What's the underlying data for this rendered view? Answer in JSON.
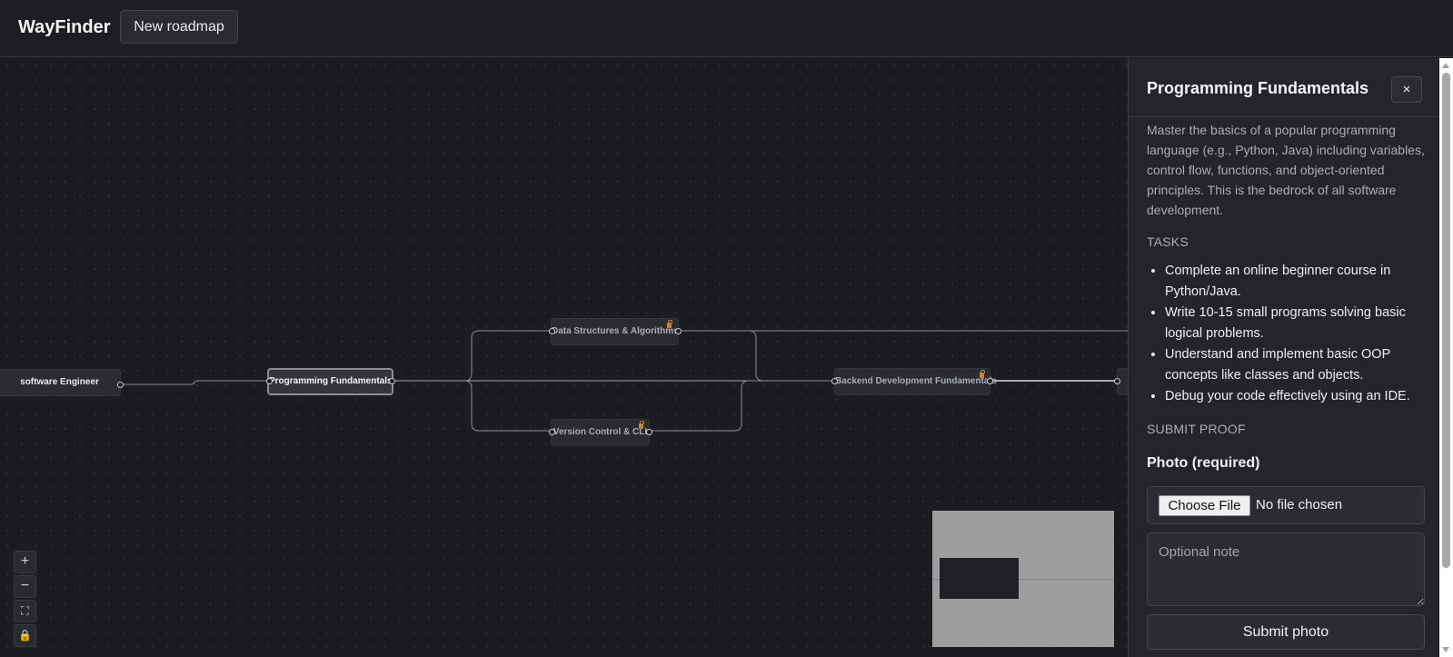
{
  "header": {
    "brand": "WayFinder",
    "new_roadmap_label": "New roadmap"
  },
  "roadmap": {
    "nodes": [
      {
        "id": "software-engineer",
        "label": "software Engineer",
        "state": "root"
      },
      {
        "id": "programming-fundamentals",
        "label": "Programming Fundamentals",
        "state": "active"
      },
      {
        "id": "data-structures",
        "label": "Data Structures & Algorithms",
        "state": "locked"
      },
      {
        "id": "version-control",
        "label": "Version Control & CLI",
        "state": "locked"
      },
      {
        "id": "backend-fundamentals",
        "label": "Backend Development Fundamentals",
        "state": "locked"
      },
      {
        "id": "next-node",
        "label": "",
        "state": "locked"
      }
    ],
    "controls": {
      "zoom_in": "+",
      "zoom_out": "−",
      "fit_view": "⛶",
      "lock": "🔒"
    }
  },
  "panel": {
    "title": "Programming Fundamentals",
    "close_label": "×",
    "description": "Master the basics of a popular programming language (e.g., Python, Java) including variables, control flow, functions, and object-oriented principles. This is the bedrock of all software development.",
    "tasks_heading": "TASKS",
    "tasks": [
      "Complete an online beginner course in Python/Java.",
      "Write 10-15 small programs solving basic logical problems.",
      "Understand and implement basic OOP concepts like classes and objects.",
      "Debug your code effectively using an IDE."
    ],
    "submit_heading": "SUBMIT PROOF",
    "photo_label": "Photo (required)",
    "choose_file_label": "Choose File",
    "file_status": "No file chosen",
    "note_placeholder": "Optional note",
    "submit_label": "Submit photo"
  },
  "colors": {
    "background": "#1b1c20",
    "panel": "#24252a",
    "lock_accent": "#c78436"
  }
}
